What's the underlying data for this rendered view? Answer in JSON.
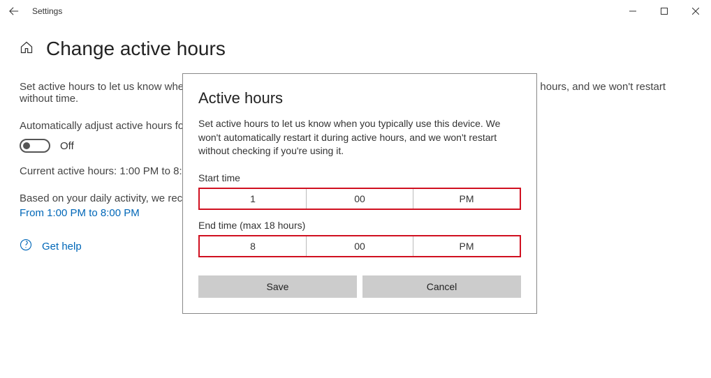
{
  "window": {
    "title": "Settings"
  },
  "page": {
    "title": "Change active hours",
    "description": "Set active hours to let us know when you typically use this device. We won't automatically restart it during active hours, and we won't restart without time.",
    "autoAdjustLabel": "Automatically adjust active hours for",
    "toggleState": "Off",
    "currentHours": "Current active hours: 1:00 PM to 8:00",
    "recommendation": "Based on your daily activity, we reco",
    "suggestedRange": "From 1:00 PM to 8:00 PM",
    "helpText": "Get help"
  },
  "dialog": {
    "title": "Active hours",
    "description": "Set active hours to let us know when you typically use this device. We won't automatically restart it during active hours, and we won't restart without checking if you're using it.",
    "startLabel": "Start time",
    "start": {
      "hour": "1",
      "minute": "00",
      "ampm": "PM"
    },
    "endLabel": "End time (max 18 hours)",
    "end": {
      "hour": "8",
      "minute": "00",
      "ampm": "PM"
    },
    "saveLabel": "Save",
    "cancelLabel": "Cancel"
  }
}
